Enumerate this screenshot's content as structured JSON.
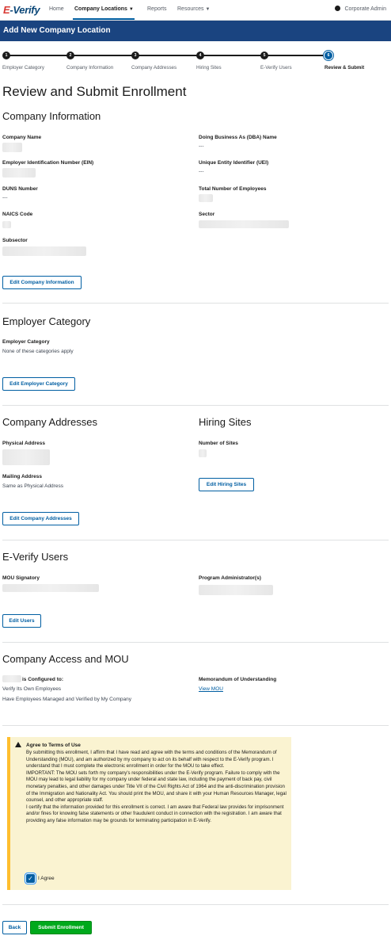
{
  "nav": {
    "logo_e": "E",
    "logo_rest": "-Verify",
    "items": [
      "Home",
      "Company Locations",
      "Reports",
      "Resources"
    ],
    "user": "Corporate Admin"
  },
  "banner": {
    "title": "Add New Company Location"
  },
  "steps": [
    {
      "num": "1",
      "label": "Employer Category"
    },
    {
      "num": "2",
      "label": "Company Information"
    },
    {
      "num": "3",
      "label": "Company Addresses"
    },
    {
      "num": "4",
      "label": "Hiring Sites"
    },
    {
      "num": "5",
      "label": "E-Verify Users"
    },
    {
      "num": "6",
      "label": "Review & Submit"
    }
  ],
  "page_title": "Review and Submit Enrollment",
  "company_info": {
    "heading": "Company Information",
    "company_name": "Company Name",
    "dba_label": "Doing Business As (DBA) Name",
    "dba_value": "---",
    "ein_label": "Employer Identification Number (EIN)",
    "uei_label": "Unique Entity Identifier (UEI)",
    "uei_value": "---",
    "duns_label": "DUNS Number",
    "duns_value": "---",
    "employees_label": "Total Number of Employees",
    "naics_label": "NAICS Code",
    "sector_label": "Sector",
    "subsector_label": "Subsector",
    "edit_button": "Edit Company Information"
  },
  "employer_category": {
    "heading": "Employer Category",
    "label": "Employer Category",
    "value": "None of these categories apply",
    "edit_button": "Edit Employer Category"
  },
  "addresses": {
    "heading": "Company Addresses",
    "physical_label": "Physical Address",
    "mailing_label": "Mailing Address",
    "mailing_value": "Same as Physical Address",
    "edit_button": "Edit Company Addresses"
  },
  "hiring_sites": {
    "heading": "Hiring Sites",
    "sites_label": "Number of Sites",
    "edit_button": "Edit Hiring Sites"
  },
  "users": {
    "heading": "E-Verify Users",
    "mou_label": "MOU Signatory",
    "admin_label": "Program Administrator(s)",
    "edit_button": "Edit Users"
  },
  "access": {
    "heading": "Company Access and MOU",
    "configured_label": "is Configured to:",
    "config_1": "Verify Its Own Employees",
    "config_2": "Have Employees Managed and Verified by My Company",
    "mou_label": "Memorandum of Understanding",
    "mou_link": "View MOU"
  },
  "terms": {
    "title": "Agree to Terms of Use",
    "p1": "By submitting this enrollment, I affirm that I have read and agree with the terms and conditions of the Memorandum of Understanding (MOU), and am authorized by my company to act on its behalf with respect to the E-Verify program. I understand that I must complete the electronic enrollment in order for the MOU to take effect.",
    "p2": "IMPORTANT: The MOU sets forth my company's responsibilities under the E-Verify program. Failure to comply with the MOU may lead to legal liability for my company under federal and state law, including the payment of back pay, civil monetary penalties, and other damages under Title VII of the Civil Rights Act of 1964 and the anti-discrimination provision of the Immigration and Nationality Act. You should print the MOU, and share it with your Human Resources Manager, legal counsel, and other appropriate staff.",
    "p3": "I certify that the information provided for this enrollment is correct. I am aware that Federal law provides for imprisonment and/or fines for knowing false statements or other fraudulent conduct in connection with the registration. I am aware that providing any false information may be grounds for terminating participation in E-Verify.",
    "agree_label": "I Agree",
    "checked": true
  },
  "footer": {
    "back": "Back",
    "submit": "Submit Enrollment"
  },
  "colors": {
    "primary": "#005ea2",
    "banner": "#1a4480",
    "success": "#00a91c",
    "warning_bg": "#faf3d1",
    "warning_border": "#ffbe2e"
  }
}
